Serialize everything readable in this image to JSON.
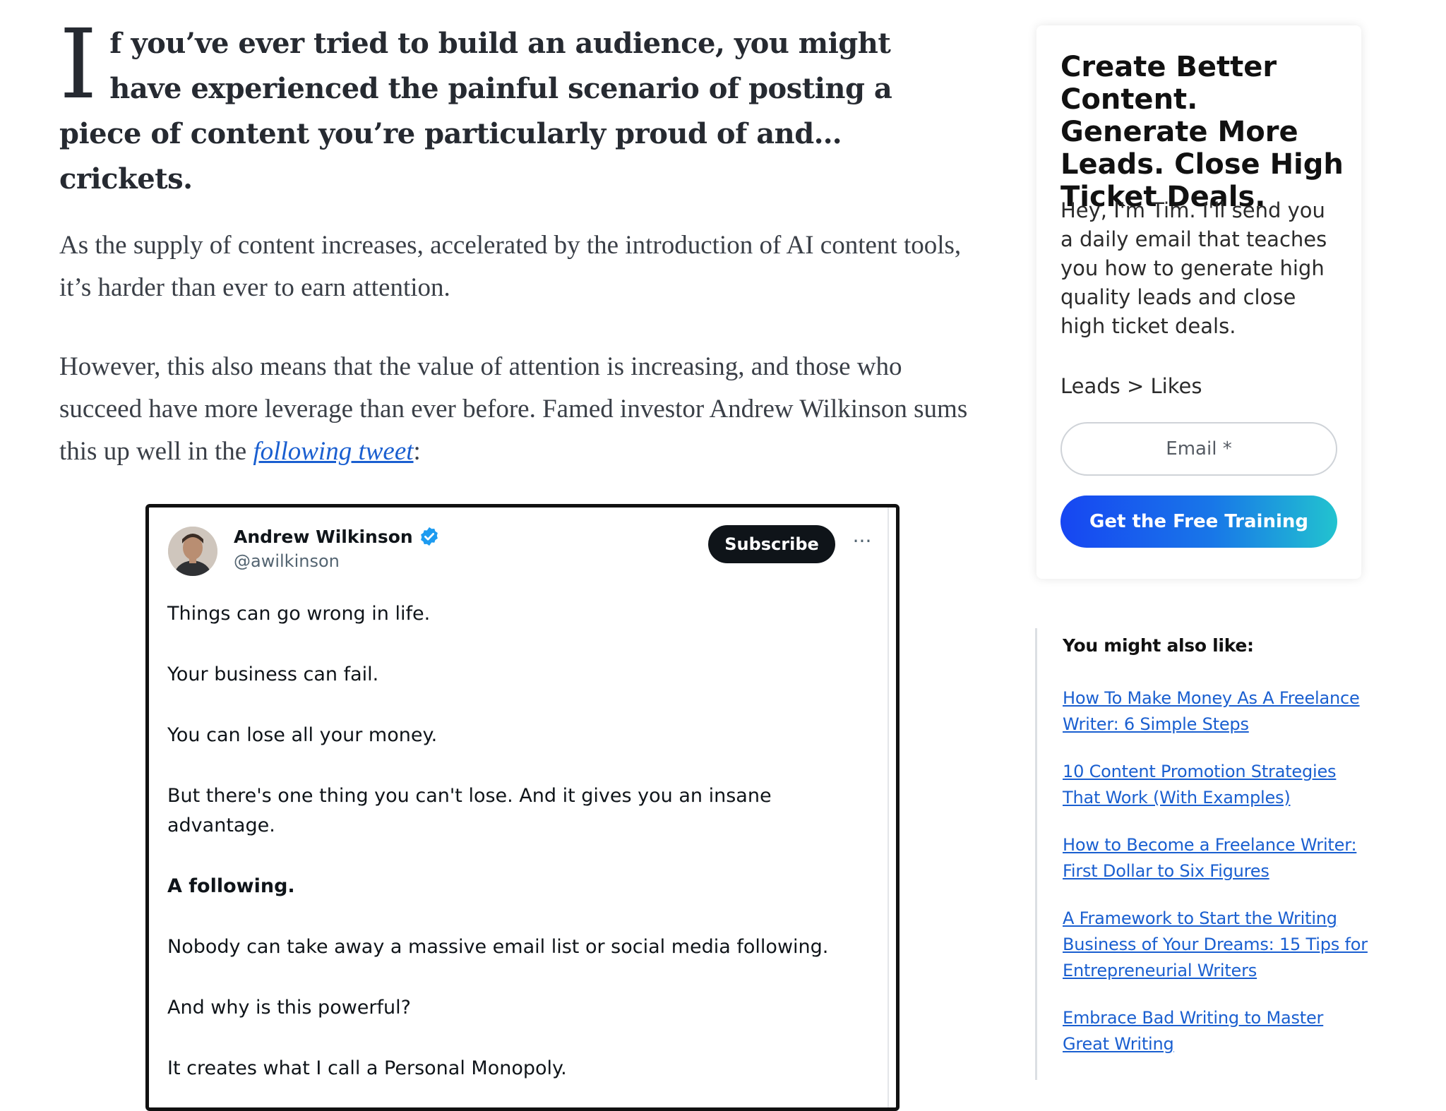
{
  "article": {
    "dropcap": "I",
    "lead_rest": "f you’ve ever tried to build an audience, you might have experienced the painful scenario of posting a piece of content you’re particularly proud of and… crickets.",
    "para1": "As the supply of content increases, accelerated by the introduction of AI content tools, it’s harder than ever to earn attention.",
    "para2_before_link": "However, this also means that the value of attention is increasing, and those who succeed have more leverage than ever before. Famed investor Andrew Wilkinson sums this up well in the ",
    "para2_link": "following tweet",
    "para2_after_link": ":"
  },
  "tweet": {
    "author_name": "Andrew Wilkinson",
    "handle": "@awilkinson",
    "subscribe_label": "Subscribe",
    "more_label": "···",
    "lines": [
      "Things can go wrong in life.",
      "Your business can fail.",
      "You can lose all your money.",
      "But there's one thing you can't lose. And it gives you an insane advantage.",
      "A following.",
      "Nobody can take away a massive email list or social media following.",
      "And why is this powerful?",
      "It creates what I call a Personal Monopoly."
    ]
  },
  "newsletter": {
    "title": "Create Better Content. Generate More Leads. Close High Ticket Deals.",
    "body": "Hey, I'm Tim. I'll send you a daily email that teaches you how to generate high quality leads and close high ticket deals.",
    "tagline": "Leads > Likes",
    "email_placeholder": "Email *",
    "cta_label": "Get the Free Training",
    "cta_gradient": [
      "#1746f2",
      "#22c3cf"
    ]
  },
  "related": {
    "title": "You might also like:",
    "links": [
      "How To Make Money As A Freelance Writer: 6 Simple Steps",
      "10 Content Promotion Strategies That Work (With Examples)",
      "How to Become a Freelance Writer: First Dollar to Six Figures",
      "A Framework to Start the Writing Business of Your Dreams: 15 Tips for Entrepreneurial Writers",
      "Embrace Bad Writing to Master Great Writing"
    ]
  },
  "colors": {
    "link": "#1a5fd0",
    "verified": "#1d9bf0"
  }
}
